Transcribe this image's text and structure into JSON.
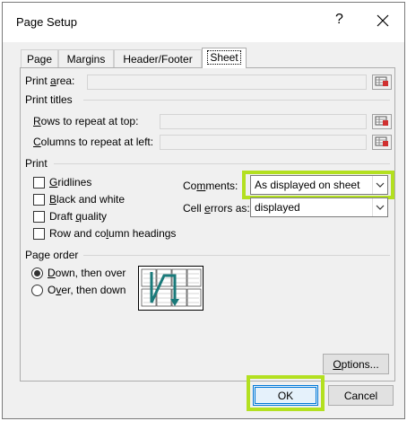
{
  "dialog": {
    "title": "Page Setup",
    "help": "?",
    "close_icon": "close-icon"
  },
  "tabs": [
    {
      "label": "Page",
      "active": false
    },
    {
      "label": "Margins",
      "active": false
    },
    {
      "label": "Header/Footer",
      "active": false
    },
    {
      "label": "Sheet",
      "active": true
    }
  ],
  "print_area": {
    "label_pre": "Print ",
    "label_u": "a",
    "label_post": "rea:",
    "value": ""
  },
  "print_titles": {
    "label": "Print titles",
    "rows": {
      "label_u": "R",
      "label_post": "ows to repeat at top:",
      "value": ""
    },
    "cols": {
      "label_u": "C",
      "label_post": "olumns to repeat at left:",
      "value": ""
    }
  },
  "print": {
    "label": "Print",
    "gridlines": {
      "label_u": "G",
      "label_post": "ridlines",
      "checked": false
    },
    "black_white": {
      "label_u": "B",
      "label_post": "lack and white",
      "checked": false
    },
    "draft": {
      "label_pre": "Draft ",
      "label_u": "q",
      "label_post": "uality",
      "checked": false
    },
    "headings": {
      "label_pre": "Row and co",
      "label_u": "l",
      "label_post": "umn headings",
      "checked": false
    },
    "comments": {
      "label_pre": "Co",
      "label_u": "m",
      "label_post": "ments:",
      "value": "As displayed on sheet"
    },
    "cell_errors": {
      "label_pre": "Cell ",
      "label_u": "e",
      "label_post": "rrors as:",
      "value": "displayed"
    }
  },
  "page_order": {
    "label": "Page order",
    "down_over": {
      "label_u": "D",
      "label_post": "own, then over",
      "selected": true
    },
    "over_down": {
      "label_pre": "O",
      "label_u": "v",
      "label_post": "er, then down",
      "selected": false
    }
  },
  "buttons": {
    "options": {
      "label_u": "O",
      "label_post": "ptions..."
    },
    "ok": "OK",
    "cancel": "Cancel"
  },
  "colors": {
    "highlight": "#b3e020",
    "accent": "#0078d7"
  }
}
